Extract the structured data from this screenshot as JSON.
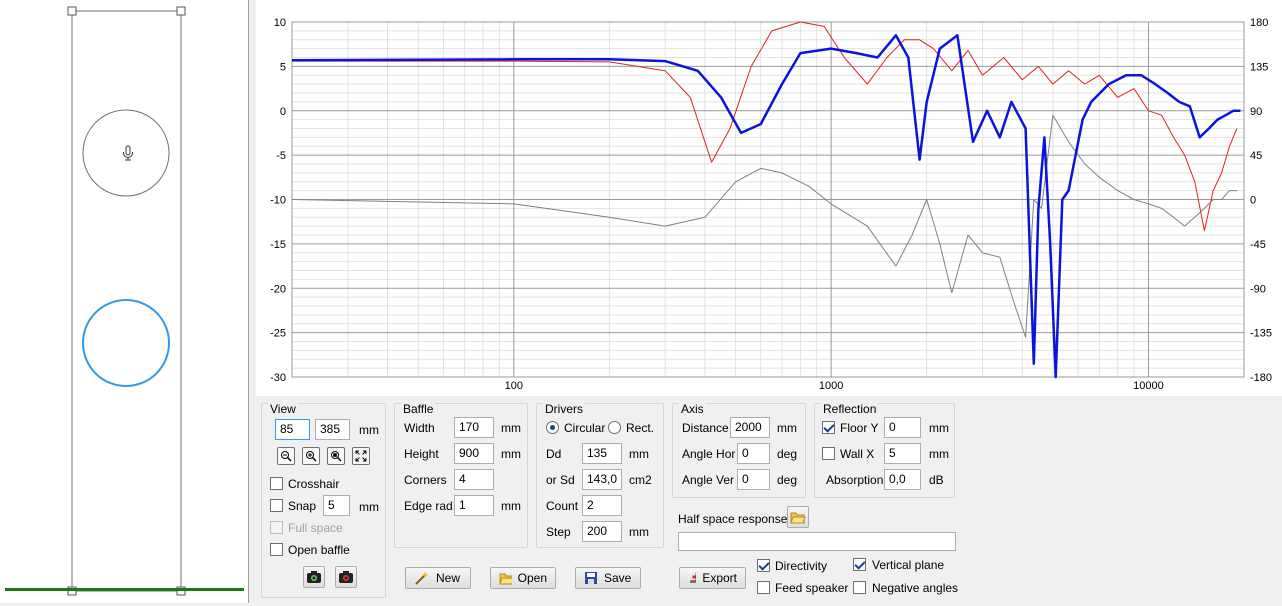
{
  "chart_data": {
    "type": "line",
    "x_scale": "log",
    "xlim": [
      20,
      20000
    ],
    "ylim_left": [
      -30,
      10
    ],
    "ylim_right": [
      -180,
      180
    ],
    "x_tick_labels": [
      "100",
      "1000",
      "10000"
    ],
    "y_left_tick_labels": [
      "10",
      "5",
      "0",
      "-5",
      "-10",
      "-15",
      "-20",
      "-25",
      "-30"
    ],
    "y_right_tick_labels": [
      "180",
      "135",
      "90",
      "45",
      "0",
      "-45",
      "-90",
      "-135",
      "-180"
    ],
    "grid": true,
    "series": [
      {
        "color": "#e02020",
        "width": 1,
        "x": [
          20,
          100,
          200,
          300,
          360,
          420,
          480,
          560,
          650,
          800,
          950,
          1100,
          1300,
          1500,
          1700,
          1900,
          2100,
          2400,
          2700,
          3000,
          3500,
          4000,
          4500,
          5000,
          5600,
          6300,
          7000,
          8000,
          9000,
          10000,
          11000,
          12000,
          13000,
          14000,
          15000,
          16000,
          17000,
          18000,
          19000
        ],
        "y": [
          5.6,
          5.6,
          5.5,
          4.5,
          1.5,
          -5.8,
          -2,
          5,
          9,
          10,
          9.5,
          6,
          3,
          6,
          8,
          8,
          7,
          4.5,
          6.8,
          4,
          6,
          3.5,
          5,
          3,
          4.5,
          3,
          4,
          1.5,
          2.5,
          0,
          -0.5,
          -3,
          -5,
          -8,
          -13.5,
          -9,
          -7,
          -4,
          -2
        ]
      },
      {
        "color": "#0a14dc",
        "width": 2.5,
        "x": [
          20,
          100,
          200,
          300,
          380,
          450,
          520,
          600,
          700,
          800,
          1000,
          1200,
          1400,
          1600,
          1750,
          1900,
          2000,
          2200,
          2500,
          2800,
          3100,
          3400,
          3700,
          4100,
          4350,
          4500,
          4700,
          4900,
          5100,
          5350,
          5600,
          6200,
          6600,
          7500,
          8500,
          9500,
          10500,
          11500,
          12500,
          13500,
          14500,
          15500,
          16500,
          17500,
          18500,
          19500
        ],
        "y": [
          5.7,
          5.8,
          5.8,
          5.6,
          4.5,
          1.5,
          -2.5,
          -1.5,
          3,
          6.5,
          7,
          6.5,
          6,
          8.5,
          6,
          -5.5,
          1,
          7,
          8.5,
          -3.5,
          0,
          -3,
          1,
          -2,
          -28.5,
          -11,
          -3,
          -15,
          -30,
          -10,
          -9,
          -1,
          1,
          3,
          4,
          4,
          3,
          2,
          1,
          0.5,
          -3,
          -2,
          -1,
          -0.5,
          0,
          0
        ]
      },
      {
        "color": "#808080",
        "width": 1,
        "x": [
          20,
          100,
          200,
          300,
          400,
          500,
          600,
          700,
          850,
          1000,
          1300,
          1600,
          1800,
          2000,
          2200,
          2400,
          2700,
          3000,
          3400,
          3800,
          4100,
          4350,
          4600,
          5000,
          5600,
          6300,
          7000,
          8000,
          9000,
          10000,
          11000,
          12000,
          13000,
          14000,
          15000,
          16000,
          17000,
          18000,
          19000
        ],
        "y": [
          -10,
          -10.5,
          -12,
          -13,
          -12,
          -8,
          -6.5,
          -7,
          -8.5,
          -10.5,
          -13,
          -17.5,
          -14,
          -10,
          -15,
          -20.5,
          -14,
          -16,
          -16.5,
          -22,
          -25.5,
          -10,
          -11,
          -0.5,
          -3.5,
          -6,
          -7.5,
          -9,
          -10,
          -10.5,
          -11,
          -12,
          -13,
          -12,
          -11,
          -10,
          -10,
          -9,
          -9
        ]
      }
    ]
  },
  "baffle_preview": {
    "outline_color": "#707070",
    "driver_colors": [
      "#707070",
      "#3399e6"
    ],
    "microphone_icon": "microphone-icon",
    "floor_color": "#1a7a1a"
  },
  "view": {
    "title": "View",
    "x_value": "85",
    "y_value": "385",
    "unit": "mm",
    "zoom_icons": [
      "zoom-out-icon",
      "zoom-in-icon",
      "zoom-fit-icon",
      "fullscreen-icon"
    ],
    "crosshair_label": "Crosshair",
    "snap_label": "Snap",
    "snap_value": "5",
    "snap_unit": "mm",
    "full_space_label": "Full space",
    "open_baffle_label": "Open baffle"
  },
  "baffle": {
    "title": "Baffle",
    "width_label": "Width",
    "width_value": "170",
    "height_label": "Height",
    "height_value": "900",
    "corners_label": "Corners",
    "corners_value": "4",
    "edge_label": "Edge rad.",
    "edge_value": "1",
    "unit": "mm"
  },
  "drivers": {
    "title": "Drivers",
    "circular_label": "Circular",
    "rect_label": "Rect.",
    "dd_label": "Dd",
    "dd_value": "135",
    "dd_unit": "mm",
    "sd_label": "or Sd",
    "sd_value": "143,0",
    "sd_unit": "cm2",
    "count_label": "Count",
    "count_value": "2",
    "step_label": "Step",
    "step_value": "200",
    "step_unit": "mm"
  },
  "axis": {
    "title": "Axis",
    "distance_label": "Distance",
    "distance_value": "2000",
    "distance_unit": "mm",
    "angle_hor_label": "Angle Hor",
    "angle_hor_value": "0",
    "angle_ver_label": "Angle Ver",
    "angle_ver_value": "0",
    "deg_unit": "deg"
  },
  "reflection": {
    "title": "Reflection",
    "floor_label": "Floor Y",
    "floor_value": "0",
    "wall_label": "Wall  X",
    "wall_value": "5",
    "absorption_label": "Absorption",
    "absorption_value": "0,0",
    "mm_unit": "mm",
    "db_unit": "dB"
  },
  "half_space": {
    "label": "Half space response",
    "path_value": ""
  },
  "options": {
    "directivity_label": "Directivity",
    "feed_speaker_label": "Feed speaker",
    "vertical_plane_label": "Vertical plane",
    "negative_angles_label": "Negative angles"
  },
  "buttons": {
    "new_label": "New",
    "open_label": "Open",
    "save_label": "Save",
    "export_label": "Export"
  }
}
